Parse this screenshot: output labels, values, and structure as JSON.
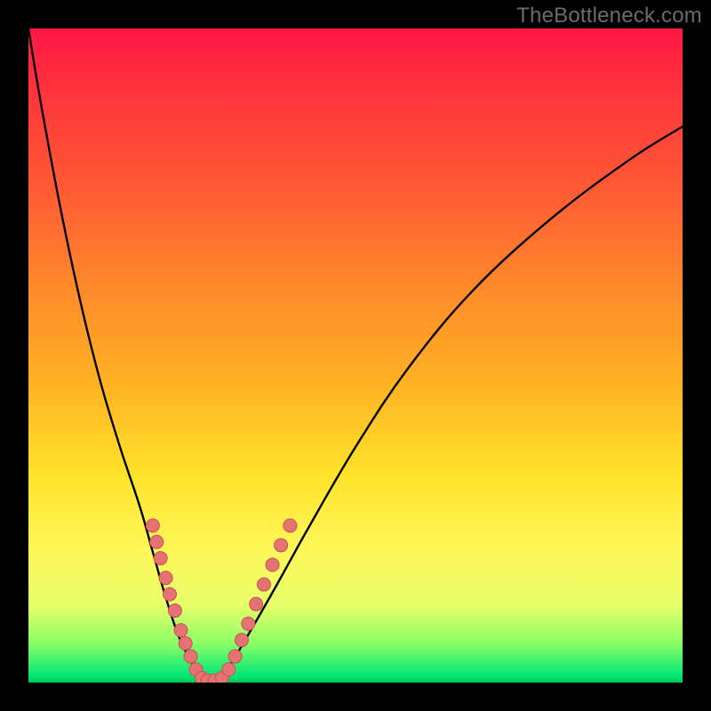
{
  "watermark": "TheBottleneck.com",
  "colors": {
    "bg": "#000000",
    "curve": "#000000",
    "dot_fill": "#e57373",
    "dot_stroke": "#c94f4f",
    "gradient_top": "#ff1744",
    "gradient_mid": "#ffe22a",
    "gradient_bottom": "#00c853"
  },
  "chart_data": {
    "type": "line",
    "title": "",
    "xlabel": "",
    "ylabel": "",
    "xlim": [
      0,
      100
    ],
    "ylim": [
      0,
      100
    ],
    "grid": false,
    "legend": false,
    "series": [
      {
        "name": "bottleneck-curve",
        "x": [
          0,
          2,
          5,
          8,
          11,
          14,
          17,
          19,
          21,
          23,
          25,
          27,
          28.5,
          31,
          34,
          38,
          43,
          50,
          58,
          68,
          80,
          92,
          100
        ],
        "y": [
          100,
          88,
          72,
          58,
          46,
          36,
          27,
          20,
          13,
          7,
          3,
          0,
          0,
          3,
          8,
          15,
          24,
          36,
          48,
          60,
          71,
          80,
          85
        ]
      }
    ],
    "markers": {
      "name": "highlight-dots",
      "points": [
        {
          "x": 19.0,
          "y": 24.0
        },
        {
          "x": 19.6,
          "y": 21.5
        },
        {
          "x": 20.2,
          "y": 19.0
        },
        {
          "x": 21.0,
          "y": 16.0
        },
        {
          "x": 21.6,
          "y": 13.5
        },
        {
          "x": 22.4,
          "y": 11.0
        },
        {
          "x": 23.3,
          "y": 8.0
        },
        {
          "x": 24.0,
          "y": 6.0
        },
        {
          "x": 24.8,
          "y": 4.0
        },
        {
          "x": 25.6,
          "y": 2.0
        },
        {
          "x": 26.5,
          "y": 0.7
        },
        {
          "x": 27.4,
          "y": 0.3
        },
        {
          "x": 28.5,
          "y": 0.3
        },
        {
          "x": 29.6,
          "y": 0.7
        },
        {
          "x": 30.6,
          "y": 2.0
        },
        {
          "x": 31.6,
          "y": 4.0
        },
        {
          "x": 32.6,
          "y": 6.5
        },
        {
          "x": 33.6,
          "y": 9.0
        },
        {
          "x": 34.8,
          "y": 12.0
        },
        {
          "x": 36.0,
          "y": 15.0
        },
        {
          "x": 37.3,
          "y": 18.0
        },
        {
          "x": 38.6,
          "y": 21.0
        },
        {
          "x": 40.0,
          "y": 24.0
        }
      ]
    }
  }
}
